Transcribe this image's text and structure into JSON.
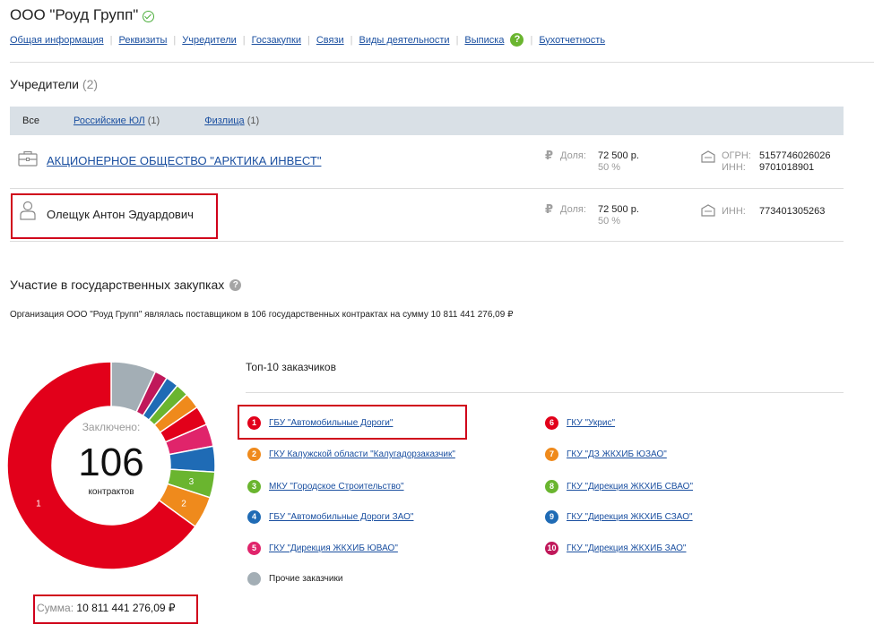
{
  "company": {
    "title": "ООО \"Роуд Групп\""
  },
  "nav": [
    "Общая информация",
    "Реквизиты",
    "Учредители",
    "Госзакупки",
    "Связи",
    "Виды деятельности",
    "Выписка",
    "Бухотчетность"
  ],
  "nav_help": "?",
  "founders": {
    "title": "Учредители",
    "count": "(2)",
    "filters": {
      "all": "Все",
      "legal": "Российские ЮЛ",
      "legal_count": "(1)",
      "individuals": "Физлица",
      "individuals_count": "(1)"
    },
    "rows": [
      {
        "name": "АКЦИОНЕРНОЕ ОБЩЕСТВО \"АРКТИКА ИНВЕСТ\"",
        "share_label": "Доля:",
        "share_amount": "72 500 р.",
        "share_percent": "50 %",
        "ogrn_label": "ОГРН:",
        "ogrn": "5157746026026",
        "inn_label": "ИНН:",
        "inn": "9701018901"
      },
      {
        "name": "Олещук Антон Эдуардович",
        "share_label": "Доля:",
        "share_amount": "72 500 р.",
        "share_percent": "50 %",
        "inn_label": "ИНН:",
        "inn": "773401305263"
      }
    ]
  },
  "gov": {
    "title": "Участие в государственных закупках",
    "help": "?",
    "summary": "Организация ООО \"Роуд Групп\" являлась поставщиком в 106 государственных контрактах на сумму 10 811 441 276,09 ₽",
    "donut": {
      "label": "Заключено:",
      "number": "106",
      "sublabel": "контрактов"
    },
    "sum_label": "Сумма:",
    "sum_value": "10 811 441 276,09 ₽",
    "top10_title": "Топ-10 заказчиков",
    "customers": [
      {
        "num": "1",
        "name": "ГБУ \"Автомобильные Дороги\"",
        "color": "#e2001a"
      },
      {
        "num": "2",
        "name": "ГКУ Калужской области \"Калугадорзаказчик\"",
        "color": "#ef8a1c"
      },
      {
        "num": "3",
        "name": "МКУ \"Городское Строительство\"",
        "color": "#6ab52f"
      },
      {
        "num": "4",
        "name": "ГБУ \"Автомобильные Дороги ЗАО\"",
        "color": "#1f6bb5"
      },
      {
        "num": "5",
        "name": "ГКУ \"Дирекция ЖКХИБ ЮВАО\"",
        "color": "#e0246b"
      },
      {
        "num": "6",
        "name": "ГКУ \"Укрис\"",
        "color": "#e2001a"
      },
      {
        "num": "7",
        "name": "ГКУ \"ДЗ ЖКХИБ ЮЗАО\"",
        "color": "#ef8a1c"
      },
      {
        "num": "8",
        "name": "ГКУ \"Дирекция ЖКХИБ СВАО\"",
        "color": "#6ab52f"
      },
      {
        "num": "9",
        "name": "ГКУ \"Дирекция ЖКХИБ СЗАО\"",
        "color": "#1f6bb5"
      },
      {
        "num": "10",
        "name": "ГКУ \"Дирекция ЖКХИБ ЗАО\"",
        "color": "#c0185a"
      }
    ],
    "others_label": "Прочие заказчики",
    "others_color": "#a3aeb5"
  },
  "chart_data": {
    "type": "pie",
    "categories": [
      "1",
      "2",
      "3",
      "4",
      "5",
      "6",
      "7",
      "8",
      "9",
      "10",
      "Прочие заказчики"
    ],
    "values": [
      65,
      5,
      4,
      4,
      3.5,
      3,
      2.5,
      2,
      2,
      2,
      7
    ],
    "colors": [
      "#e2001a",
      "#ef8a1c",
      "#6ab52f",
      "#1f6bb5",
      "#e0246b",
      "#e2001a",
      "#ef8a1c",
      "#6ab52f",
      "#1f6bb5",
      "#c0185a",
      "#a3aeb5"
    ],
    "segment_labels": [
      "1",
      "2",
      "3"
    ]
  }
}
